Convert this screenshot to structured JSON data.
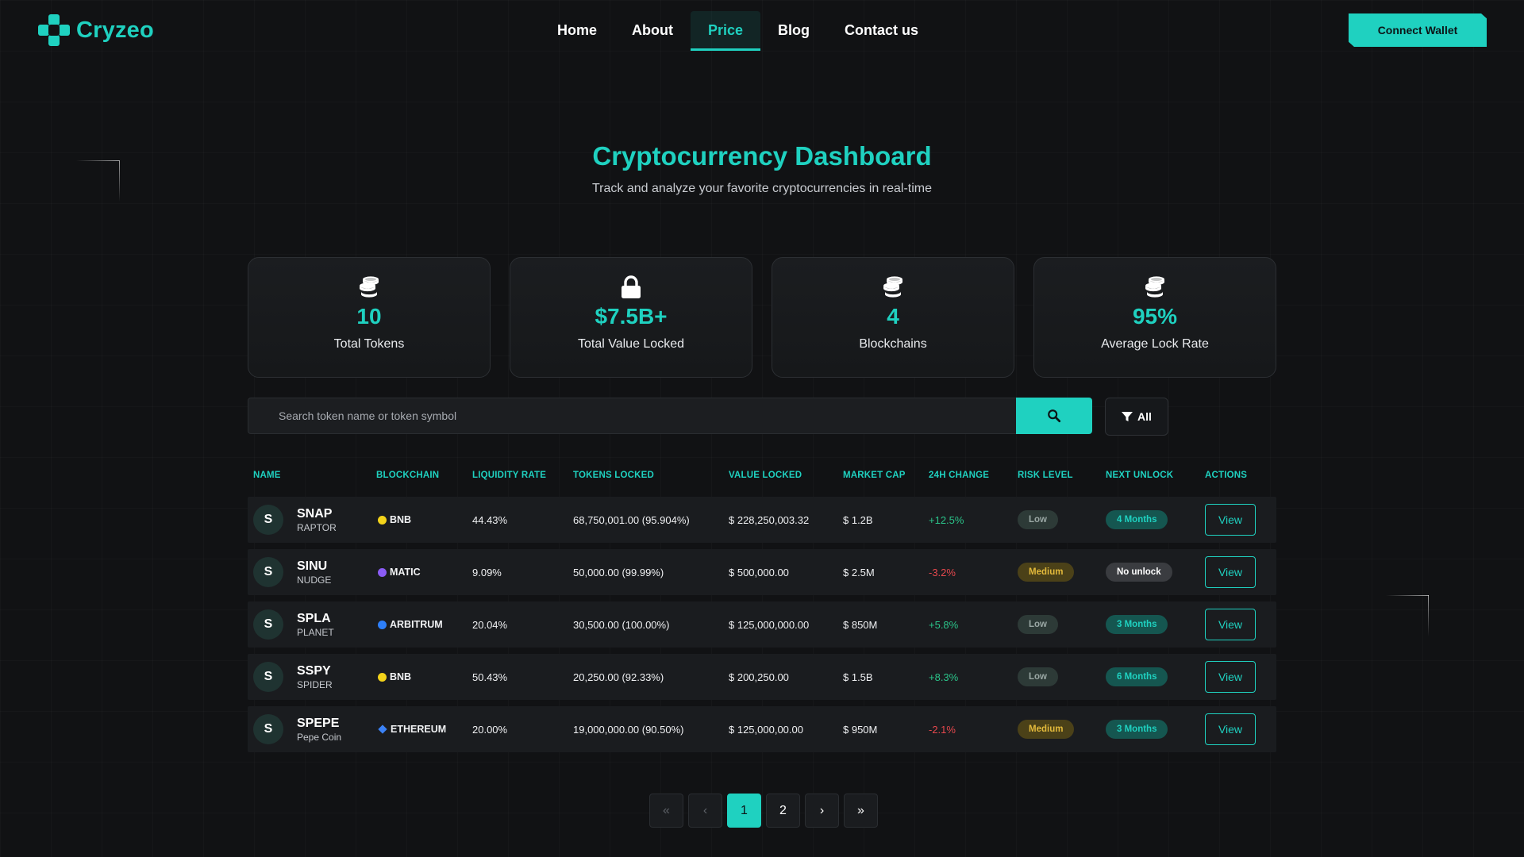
{
  "brand": {
    "name": "Cryzeo"
  },
  "nav": {
    "items": [
      {
        "label": "Home",
        "active": false
      },
      {
        "label": "About",
        "active": false
      },
      {
        "label": "Price",
        "active": true
      },
      {
        "label": "Blog",
        "active": false
      },
      {
        "label": "Contact us",
        "active": false
      }
    ],
    "connect_label": "Connect Wallet"
  },
  "hero": {
    "title": "Cryptocurrency Dashboard",
    "subtitle": "Track and analyze your favorite cryptocurrencies in real-time"
  },
  "stats": [
    {
      "icon": "coins-icon",
      "value": "10",
      "label": "Total Tokens"
    },
    {
      "icon": "lock-icon",
      "value": "$7.5B+",
      "label": "Total Value Locked"
    },
    {
      "icon": "coins-icon",
      "value": "4",
      "label": "Blockchains"
    },
    {
      "icon": "coins-icon",
      "value": "95%",
      "label": "Average Lock Rate"
    }
  ],
  "search": {
    "placeholder": "Search token name or token symbol",
    "value": "",
    "filter_label": "All"
  },
  "table": {
    "headers": [
      "NAME",
      "BLOCKCHAIN",
      "LIQUIDITY RATE",
      "TOKENS LOCKED",
      "VALUE LOCKED",
      "MARKET CAP",
      "24H CHANGE",
      "RISK LEVEL",
      "NEXT UNLOCK",
      "ACTIONS"
    ],
    "rows": [
      {
        "avatar": "S",
        "symbol": "SNAP",
        "name": "RAPTOR",
        "chain": "BNB",
        "chain_color": "#f3d31a",
        "chain_shape": "dot",
        "liquidity": "44.43%",
        "tokens_locked": "68,750,001.00 (95.904%)",
        "value_locked": "$ 228,250,003.32",
        "market_cap": "$ 1.2B",
        "change": "+12.5%",
        "change_dir": "pos",
        "risk": "Low",
        "unlock": "4 Months",
        "action": "View"
      },
      {
        "avatar": "S",
        "symbol": "SINU",
        "name": "NUDGE",
        "chain": "MATIC",
        "chain_color": "#8b5cf6",
        "chain_shape": "dot",
        "liquidity": "9.09%",
        "tokens_locked": "50,000.00 (99.99%)",
        "value_locked": "$ 500,000.00",
        "market_cap": "$ 2.5M",
        "change": "-3.2%",
        "change_dir": "neg",
        "risk": "Medium",
        "unlock": "No unlock",
        "action": "View"
      },
      {
        "avatar": "S",
        "symbol": "SPLA",
        "name": "PLANET",
        "chain": "ARBITRUM",
        "chain_color": "#2d7ff9",
        "chain_shape": "dot",
        "liquidity": "20.04%",
        "tokens_locked": "30,500.00 (100.00%)",
        "value_locked": "$ 125,000,000.00",
        "market_cap": "$ 850M",
        "change": "+5.8%",
        "change_dir": "pos",
        "risk": "Low",
        "unlock": "3 Months",
        "action": "View"
      },
      {
        "avatar": "S",
        "symbol": "SSPY",
        "name": "SPIDER",
        "chain": "BNB",
        "chain_color": "#f3d31a",
        "chain_shape": "dot",
        "liquidity": "50.43%",
        "tokens_locked": "20,250.00 (92.33%)",
        "value_locked": "$ 200,250.00",
        "market_cap": "$ 1.5B",
        "change": "+8.3%",
        "change_dir": "pos",
        "risk": "Low",
        "unlock": "6 Months",
        "action": "View"
      },
      {
        "avatar": "S",
        "symbol": "SPEPE",
        "name": "Pepe Coin",
        "chain": "ETHEREUM",
        "chain_color": "#3b82f6",
        "chain_shape": "diamond",
        "liquidity": "20.00%",
        "tokens_locked": "19,000,000.00 (90.50%)",
        "value_locked": "$ 125,000,00.00",
        "market_cap": "$ 950M",
        "change": "-2.1%",
        "change_dir": "neg",
        "risk": "Medium",
        "unlock": "3 Months",
        "action": "View"
      }
    ]
  },
  "pagination": {
    "first": "«",
    "prev": "‹",
    "pages": [
      "1",
      "2"
    ],
    "current": "1",
    "next": "›",
    "last": "»"
  }
}
